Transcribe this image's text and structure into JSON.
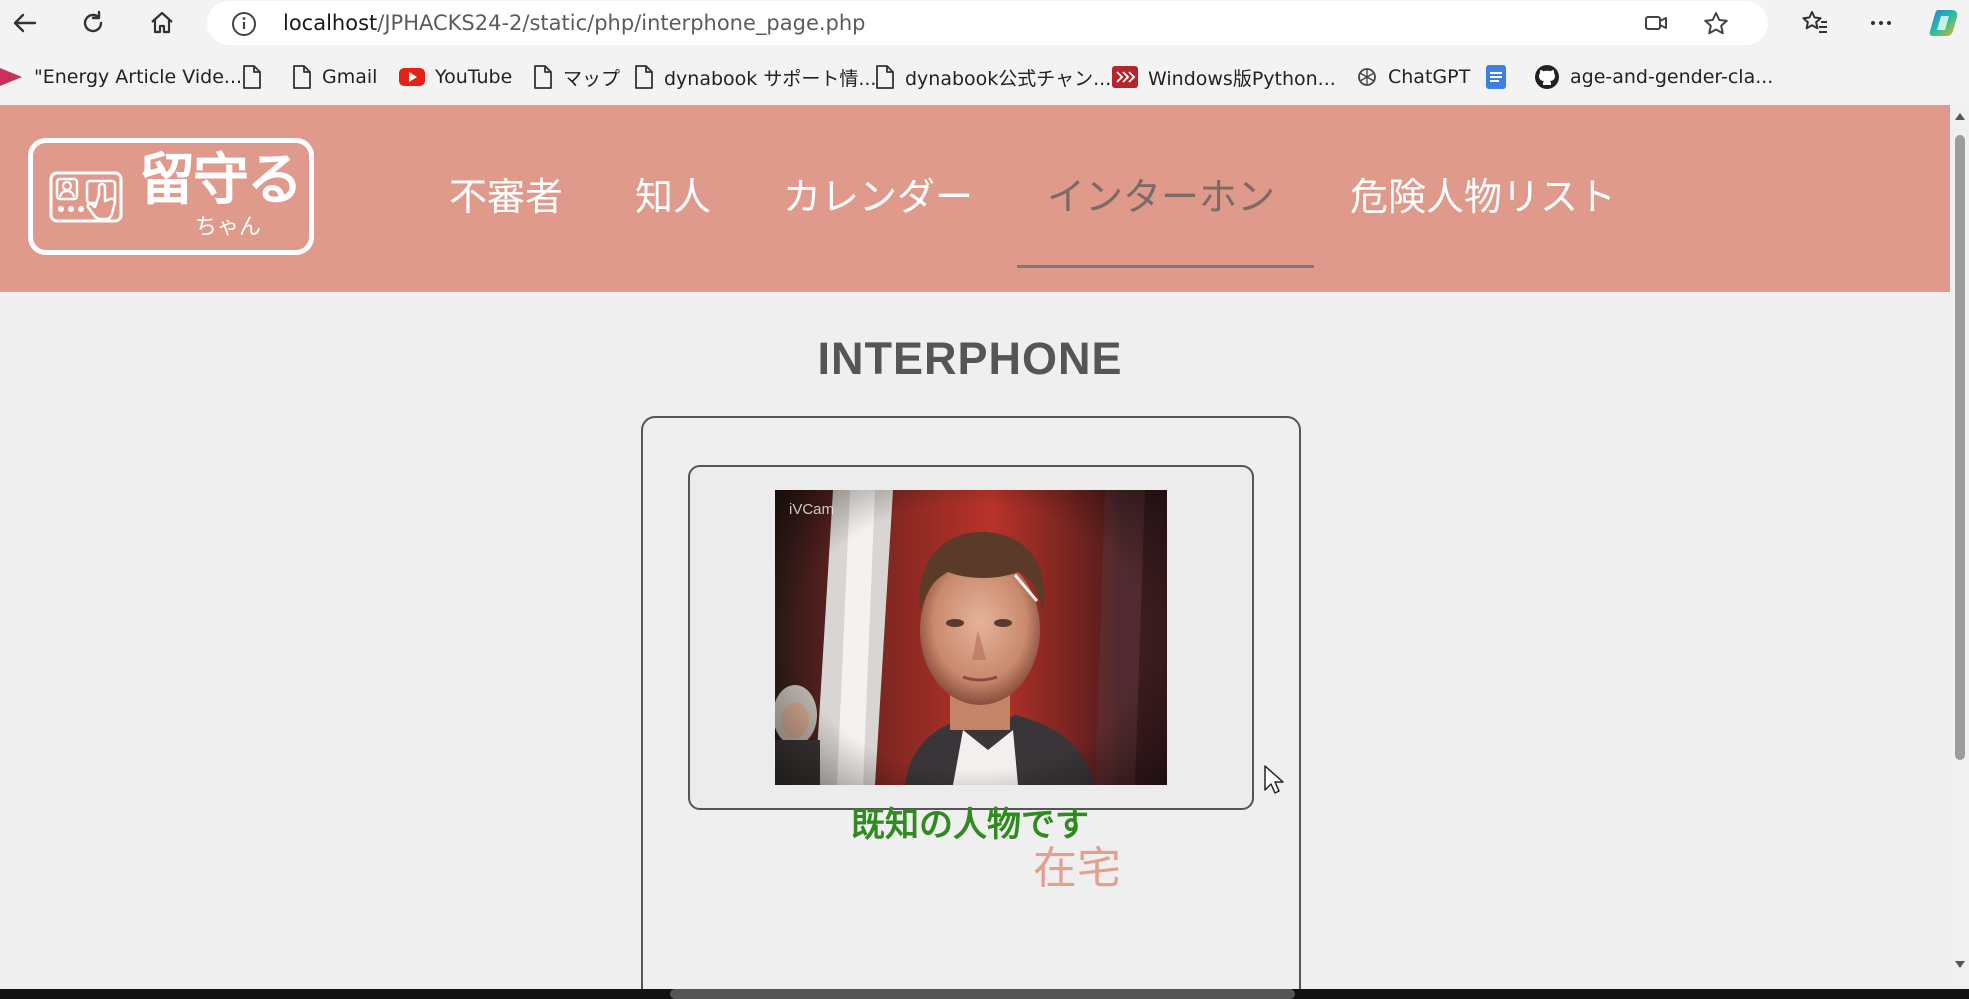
{
  "browser": {
    "url_host": "localhost",
    "url_path": "/JPHACKS24-2/static/php/interphone_page.php"
  },
  "bookmarks": [
    {
      "label": "\"Energy Article Vide...",
      "icon": "play-icon"
    },
    {
      "label": "",
      "icon": "document-icon"
    },
    {
      "label": "Gmail",
      "icon": "document-icon"
    },
    {
      "label": "YouTube",
      "icon": "youtube-icon"
    },
    {
      "label": "マップ",
      "icon": "document-icon"
    },
    {
      "label": "dynabook サポート情...",
      "icon": "document-icon"
    },
    {
      "label": "dynabook公式チャン...",
      "icon": "document-icon"
    },
    {
      "label": "Windows版Python...",
      "icon": "red-chevrons-icon"
    },
    {
      "label": "ChatGPT",
      "icon": "chatgpt-icon"
    },
    {
      "label": "",
      "icon": "docs-icon"
    },
    {
      "label": "age-and-gender-cla...",
      "icon": "github-icon"
    }
  ],
  "logo": {
    "title": "留守る",
    "subtitle": "ちゃん"
  },
  "nav": [
    {
      "label": "不審者",
      "active": false
    },
    {
      "label": "知人",
      "active": false
    },
    {
      "label": "カレンダー",
      "active": false
    },
    {
      "label": "インターホン",
      "active": true
    },
    {
      "label": "危険人物リスト",
      "active": false
    }
  ],
  "page": {
    "title": "INTERPHONE",
    "camera_overlay": "iVCam",
    "status_known": "既知の人物です",
    "status_home": "在宅"
  },
  "colors": {
    "header_bg": "#e09a8c",
    "known_text": "#2f8a1f",
    "home_text": "#e3a090",
    "active_nav": "#7b6a68"
  }
}
